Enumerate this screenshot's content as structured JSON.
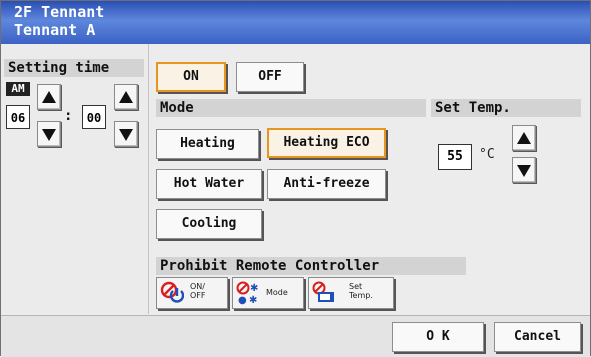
{
  "title": {
    "line1": "2F Tennant",
    "line2": "Tennant A"
  },
  "setting_time": {
    "label": "Setting time",
    "ampm": "AM",
    "hour": "06",
    "minute": "00",
    "separator": ":"
  },
  "power": {
    "on_label": "ON",
    "off_label": "OFF",
    "selected": "ON"
  },
  "mode": {
    "label": "Mode",
    "buttons": {
      "heating": "Heating",
      "heating_eco": "Heating ECO",
      "hot_water": "Hot Water",
      "anti_freeze": "Anti-freeze",
      "cooling": "Cooling"
    },
    "selected": "Heating ECO"
  },
  "set_temp": {
    "label": "Set Temp.",
    "value": "55",
    "unit": "°C"
  },
  "prohibit": {
    "label": "Prohibit Remote Controller",
    "buttons": [
      {
        "label_line1": "ON/",
        "label_line2": "OFF",
        "icon": "power-prohibit-icon"
      },
      {
        "label_line1": "Mode",
        "label_line2": "",
        "icon": "mode-prohibit-icon"
      },
      {
        "label_line1": "Set",
        "label_line2": "Temp.",
        "icon": "settemp-prohibit-icon"
      }
    ]
  },
  "footer": {
    "ok_label": "O K",
    "cancel_label": "Cancel"
  },
  "colors": {
    "title_bar": "#3b62c5",
    "selected_border": "#e8951e",
    "prohibit_red": "#d81f1f"
  }
}
